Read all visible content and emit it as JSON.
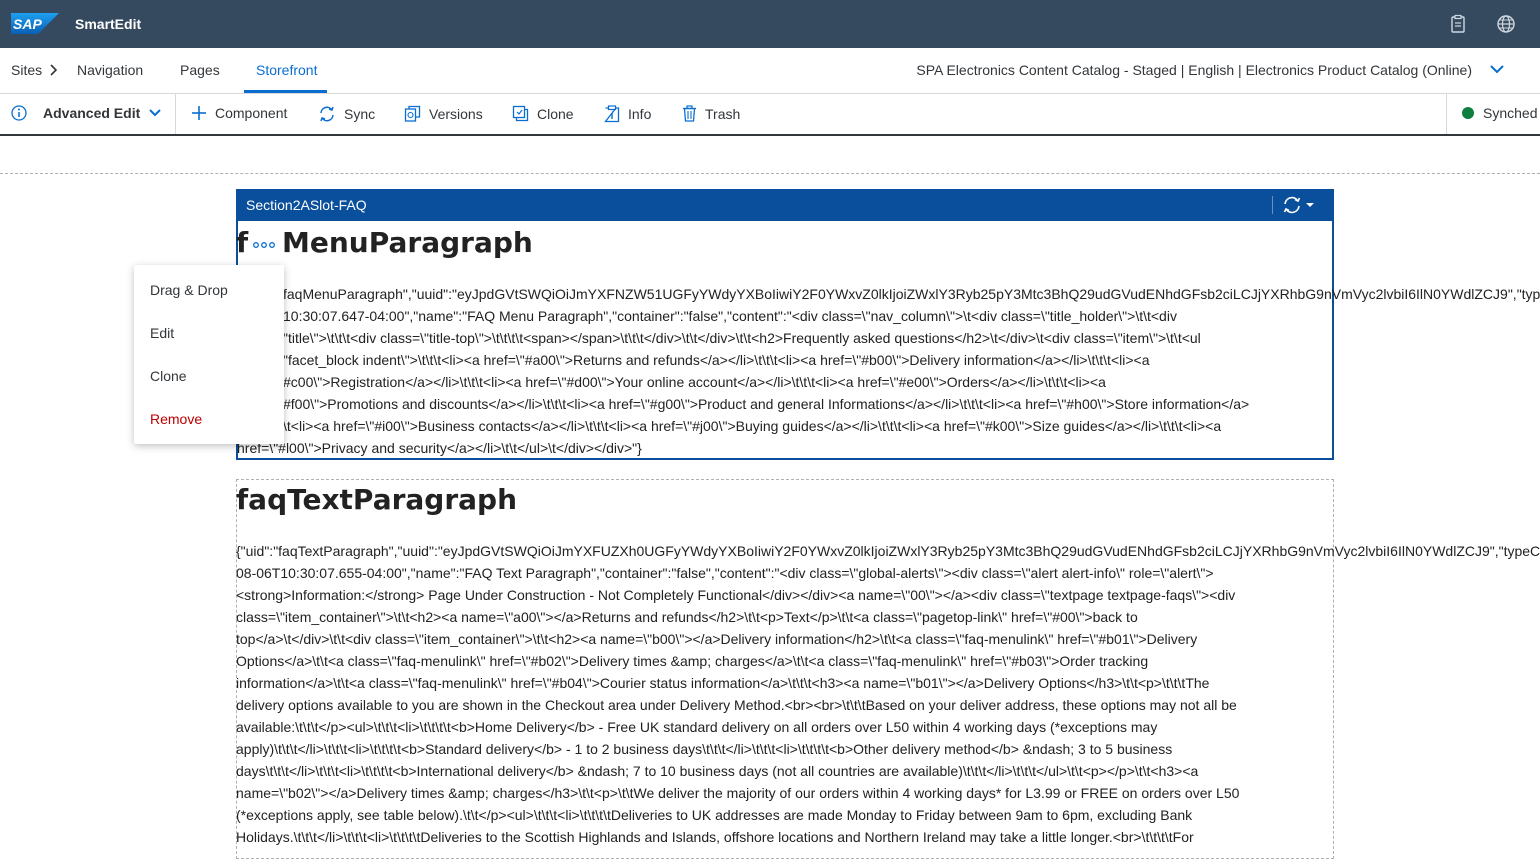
{
  "shell": {
    "logo_text": "SAP",
    "app_title": "SmartEdit",
    "icons": [
      "clipboard-icon",
      "globe-icon"
    ]
  },
  "nav": {
    "items": [
      "Sites",
      "Navigation",
      "Pages",
      "Storefront"
    ],
    "active": "Storefront",
    "catalog": "SPA Electronics Content Catalog - Staged | English | Electronics Product Catalog (Online)"
  },
  "toolbar": {
    "advanced_edit": "Advanced Edit",
    "component": "Component",
    "sync": "Sync",
    "versions": "Versions",
    "clone": "Clone",
    "info": "Info",
    "trash": "Trash",
    "status": "Synched",
    "status_color": "#107e3e"
  },
  "slot": {
    "title": "Section2ASlot-FAQ"
  },
  "component1": {
    "heading_prefix": "f",
    "heading": "MenuParagraph",
    "lines": [
      "faqMenuParagraph\",\"uuid\":\"eyJpdGVtSWQiOiJmYXFNZW51UGFyYWdyYXBoIiwiY2F0YWxvZ0lkIjoiZWxlY3Ryb25pY3Mtc3BhQ29udGVudENhdGFsb2ciLCJjYXRhbG9nVmVyc2lvbiI6IlN0YWdlZCJ9\",\"type",
      "10:30:07.647-04:00\",\"name\":\"FAQ Menu Paragraph\",\"container\":\"false\",\"content\":\"<div class=\\\"nav_column\\\">\\t<div class=\\\"title_holder\\\">\\t\\t<div",
      "\"title\\\">\\t\\t\\t<div class=\\\"title-top\\\">\\t\\t\\t\\t<span></span>\\t\\t\\t</div>\\t\\t</div>\\t\\t<h2>Frequently asked questions</h2>\\t</div>\\t<div class=\\\"item\\\">\\t\\t<ul",
      "\"facet_block indent\\\">\\t\\t\\t<li><a href=\\\"#a00\\\">Returns and refunds</a></li>\\t\\t\\t<li><a href=\\\"#b00\\\">Delivery information</a></li>\\t\\t\\t<li><a",
      "#c00\\\">Registration</a></li>\\t\\t\\t<li><a href=\\\"#d00\\\">Your online account</a></li>\\t\\t\\t<li><a href=\\\"#e00\\\">Orders</a></li>\\t\\t\\t<li><a",
      "#f00\\\">Promotions and discounts</a></li>\\t\\t\\t<li><a href=\\\"#g00\\\">Product and general Informations</a></li>\\t\\t\\t<li><a href=\\\"#h00\\\">Store information</a>",
      "\\t<li><a href=\\\"#i00\\\">Business contacts</a></li>\\t\\t\\t<li><a href=\\\"#j00\\\">Buying guides</a></li>\\t\\t\\t<li><a href=\\\"#k00\\\">Size guides</a></li>\\t\\t\\t<li><a",
      "href=\\\"#l00\\\">Privacy and security</a></li>\\t\\t</ul>\\t</div></div>\"}"
    ]
  },
  "component2": {
    "heading": "faqTextParagraph",
    "lines": [
      "{\"uid\":\"faqTextParagraph\",\"uuid\":\"eyJpdGVtSWQiOiJmYXFUZXh0UGFyYWdyYXBoIiwiY2F0YWxvZ0lkIjoiZWxlY3Ryb25pY3Mtc3BhQ29udGVudENhdGFsb2ciLCJjYXRhbG9nVmVyc2lvbiI6IlN0YWdlZCJ9\",\"typeC",
      "08-06T10:30:07.655-04:00\",\"name\":\"FAQ Text Paragraph\",\"container\":\"false\",\"content\":\"<div class=\\\"global-alerts\\\"><div class=\\\"alert alert-info\\\" role=\\\"alert\\\">",
      "<strong>Information:</strong> Page Under Construction - Not Completely Functional</div></div><a name=\\\"00\\\"></a><div class=\\\"textpage textpage-faqs\\\"><div",
      "class=\\\"item_container\\\">\\t\\t<h2><a name=\\\"a00\\\"></a>Returns and refunds</h2>\\t\\t<p>Text</p>\\t\\t<a class=\\\"pagetop-link\\\" href=\\\"#00\\\">back to",
      "top</a>\\t</div>\\t\\t<div class=\\\"item_container\\\">\\t\\t<h2><a name=\\\"b00\\\"></a>Delivery information</h2>\\t\\t<a class=\\\"faq-menulink\\\" href=\\\"#b01\\\">Delivery",
      "Options</a>\\t\\t<a class=\\\"faq-menulink\\\" href=\\\"#b02\\\">Delivery times &amp; charges</a>\\t\\t<a class=\\\"faq-menulink\\\" href=\\\"#b03\\\">Order tracking",
      "information</a>\\t\\t<a class=\\\"faq-menulink\\\" href=\\\"#b04\\\">Courier status information</a>\\t\\t\\t<h3><a name=\\\"b01\\\"></a>Delivery Options</h3>\\t\\t<p>\\t\\t\\tThe",
      "delivery options available to you are shown in the Checkout area under Delivery Method.<br><br>\\t\\t\\tBased on your deliver address, these options may not all be",
      "available:\\t\\t\\t</p><ul>\\t\\t\\t<li>\\t\\t\\t\\t<b>Home Delivery</b> - Free UK standard delivery on all orders over L50 within 4 working days (*exceptions may",
      "apply)\\t\\t\\t</li>\\t\\t\\t<li>\\t\\t\\t\\t<b>Standard delivery</b> - 1 to 2 business days\\t\\t\\t</li>\\t\\t\\t<li>\\t\\t\\t\\t<b>Other delivery method</b> &ndash; 3 to 5 business",
      "days\\t\\t\\t</li>\\t\\t\\t<li>\\t\\t\\t\\t<b>International delivery</b> &ndash; 7 to 10 business days (not all countries are available)\\t\\t\\t</li>\\t\\t\\t</ul>\\t\\t<p></p>\\t\\t<h3><a",
      "name=\\\"b02\\\"></a>Delivery times &amp; charges</h3>\\t\\t<p>\\t\\tWe deliver the majority of our orders within 4 working days* for L3.99 or FREE on orders over L50",
      "(*exceptions apply, see table below).\\t\\t</p><ul>\\t\\t\\t<li>\\t\\t\\t\\tDeliveries to UK addresses are made Monday to Friday between 9am to 6pm, excluding Bank",
      "Holidays.\\t\\t\\t</li>\\t\\t\\t<li>\\t\\t\\t\\tDeliveries to the Scottish Highlands and Islands, offshore locations and Northern Ireland may take a little longer.<br>\\t\\t\\t\\tFor"
    ]
  },
  "context_menu": {
    "items": [
      "Drag & Drop",
      "Edit",
      "Clone",
      "Remove"
    ]
  }
}
